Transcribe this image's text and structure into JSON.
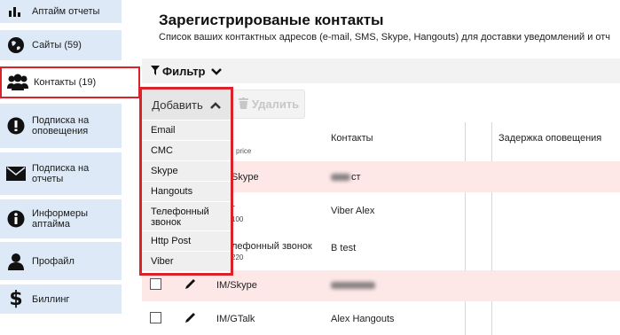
{
  "sidebar": {
    "items": [
      {
        "label": "Аптайм отчеты",
        "icon": "chart-icon"
      },
      {
        "label": "Сайты (59)",
        "icon": "globe-icon"
      },
      {
        "label": "Контакты (19)",
        "icon": "users-icon"
      },
      {
        "label": "Подписка на оповещения",
        "icon": "alert-icon"
      },
      {
        "label": "Подписка на отчеты",
        "icon": "envelope-icon"
      },
      {
        "label": "Информеры аптайма",
        "icon": "info-icon"
      },
      {
        "label": "Профайл",
        "icon": "user-icon"
      },
      {
        "label": "Биллинг",
        "icon": "dollar-icon"
      }
    ]
  },
  "header": {
    "title": "Зарегистрированые контакты",
    "subtitle": "Список ваших контактных адресов (e-mail, SMS, Skype, Hangouts) для доставки уведомлений и отч"
  },
  "filter": {
    "label": "Фильтр"
  },
  "toolbar": {
    "add_label": "Добавить",
    "delete_label": "Удалить"
  },
  "dropdown": {
    "items": [
      "Email",
      "СМС",
      "Skype",
      "Hangouts",
      "Телефонный звонок",
      "Http Post",
      "Viber"
    ]
  },
  "table": {
    "headers": {
      "type_sub": "price",
      "contacts": "Контакты",
      "delay": "Задержка оповещения"
    },
    "rows": [
      {
        "type": "Skype",
        "sub": "",
        "contact": "",
        "contact_suffix": "ст"
      },
      {
        "type": "r",
        "sub": "100",
        "contact": "Viber Alex",
        "contact_suffix": ""
      },
      {
        "type": "лефонный звонок",
        "sub": "220",
        "contact": "B test",
        "contact_suffix": ""
      },
      {
        "type": "IM/Skype",
        "sub": "",
        "contact": "",
        "contact_suffix": ""
      },
      {
        "type": "IM/GTalk",
        "sub": "",
        "contact": "Alex Hangouts",
        "contact_suffix": ""
      }
    ]
  },
  "colors": {
    "accent_red": "#d9222a",
    "sidebar_bg": "#dde9f6",
    "row_pink": "#fde7e7"
  }
}
